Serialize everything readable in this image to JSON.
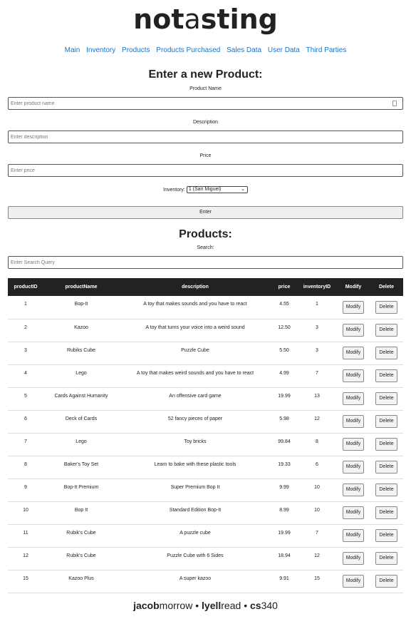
{
  "logo": {
    "part1": "not",
    "part2": "a",
    "part3": "sting"
  },
  "nav": [
    "Main",
    "Inventory",
    "Products",
    "Products Purchased",
    "Sales Data",
    "User Data",
    "Third Parties"
  ],
  "form": {
    "heading": "Enter a new Product:",
    "name_label": "Product Name",
    "name_placeholder": "Enter product name",
    "desc_label": "Description",
    "desc_placeholder": "Enter description",
    "price_label": "Price",
    "price_placeholder": "Enter price",
    "inventory_label": "Inventory:",
    "inventory_selected": "1 (San Miguel)",
    "enter_label": "Enter"
  },
  "products": {
    "heading": "Products:",
    "search_label": "Search:",
    "search_placeholder": "Enter Search Query",
    "columns": [
      "productID",
      "productName",
      "description",
      "price",
      "inventoryID",
      "Modify",
      "Delete"
    ],
    "modify_label": "Modify",
    "delete_label": "Delete",
    "rows": [
      [
        "1",
        "Bop-It",
        "A toy that makes sounds and you have to react",
        "4.55",
        "1"
      ],
      [
        "2",
        "Kazoo",
        "A toy that turns your voice into a weird sound",
        "12.50",
        "3"
      ],
      [
        "3",
        "Rubiks Cube",
        "Puzzle Cube",
        "5.50",
        "3"
      ],
      [
        "4",
        "Lego",
        "A toy that makes weird sounds and you have to react",
        "4.99",
        "7"
      ],
      [
        "5",
        "Cards Against Humanity",
        "An offensive card game",
        "19.99",
        "13"
      ],
      [
        "6",
        "Deck of Cards",
        "52 fancy pieces of paper",
        "5.98",
        "12"
      ],
      [
        "7",
        "Lego",
        "Toy bricks",
        "99.84",
        "8"
      ],
      [
        "8",
        "Baker's Toy Set",
        "Learn to bake with these plastic tools",
        "19.33",
        "6"
      ],
      [
        "9",
        "Bop-It Premium",
        "Super Premium Bop It",
        "9.99",
        "10"
      ],
      [
        "10",
        "Bop It",
        "Standard Edition Bop-It",
        "8.99",
        "10"
      ],
      [
        "11",
        "Rubik's Cube",
        "A puzzle cube",
        "19.99",
        "7"
      ],
      [
        "12",
        "Rubik's Cube",
        "Puzzle Cube with 6 Sides",
        "18.94",
        "12"
      ],
      [
        "15",
        "Kazoo Plus",
        "A super kazoo",
        "9.91",
        "15"
      ]
    ]
  },
  "footer": {
    "a_bold": "jacob",
    "a_rest": "morrow",
    "sep": "•",
    "b_bold": "lyell",
    "b_rest": "read",
    "c_bold": "cs",
    "c_rest": "340"
  }
}
